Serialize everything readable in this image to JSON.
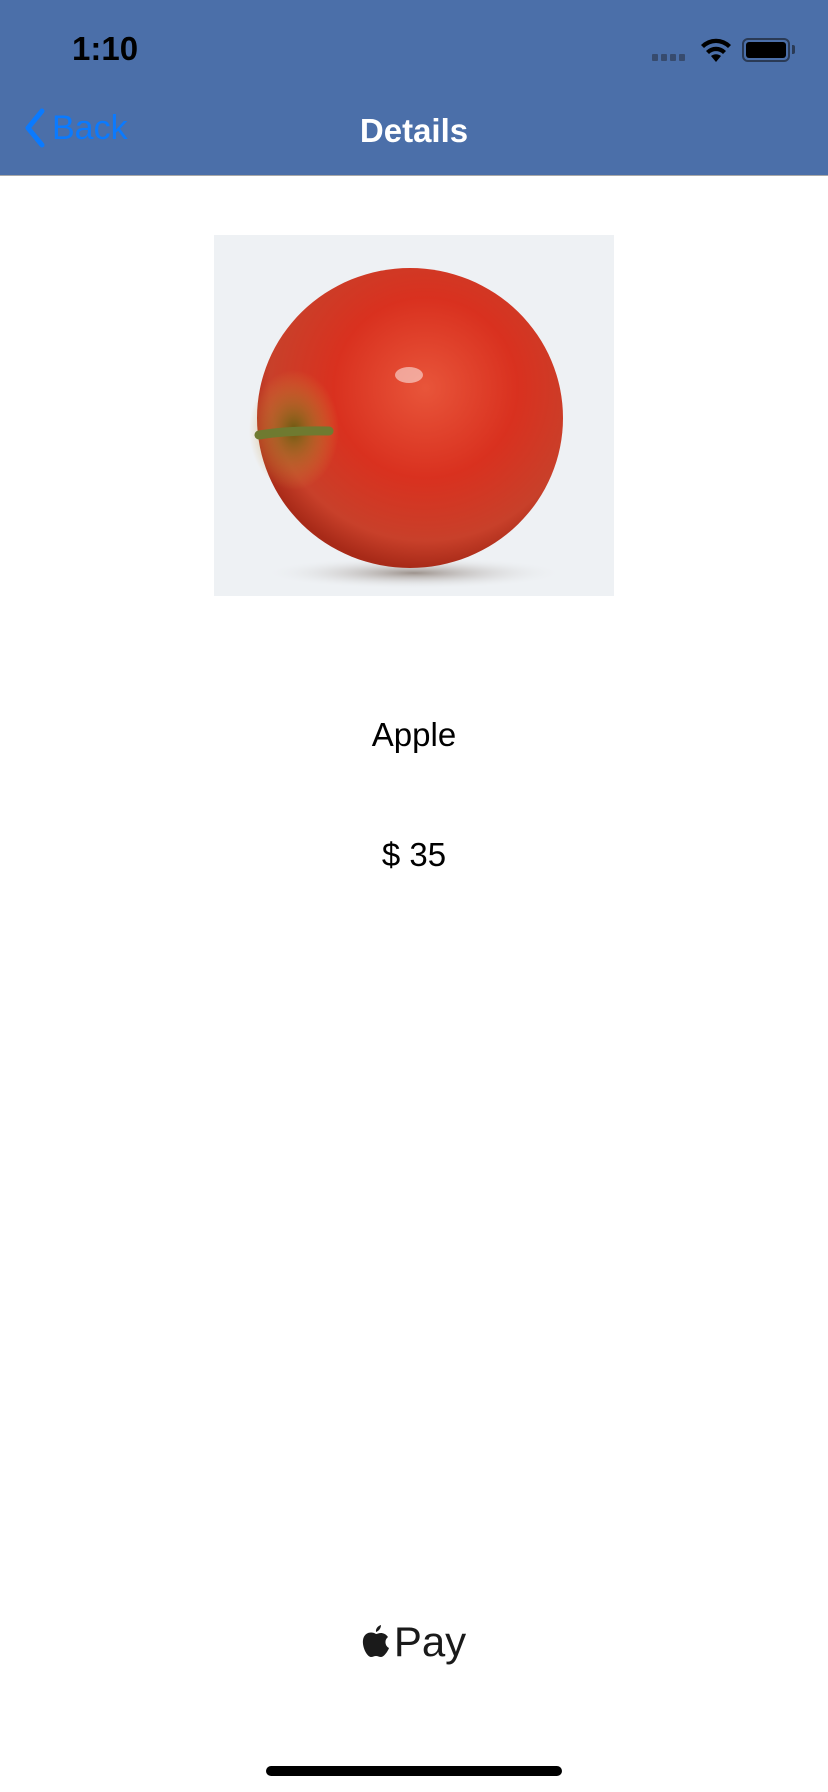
{
  "status_bar": {
    "time": "1:10",
    "icons": [
      "signal-icon",
      "wifi-icon",
      "battery-icon"
    ]
  },
  "nav": {
    "back_label": "Back",
    "title": "Details",
    "background": "#4b6fa9",
    "back_color": "#0a7aff"
  },
  "product": {
    "name": "Apple",
    "price": "$ 35",
    "image": "apple-photo"
  },
  "apple_pay": {
    "label": "Pay"
  }
}
